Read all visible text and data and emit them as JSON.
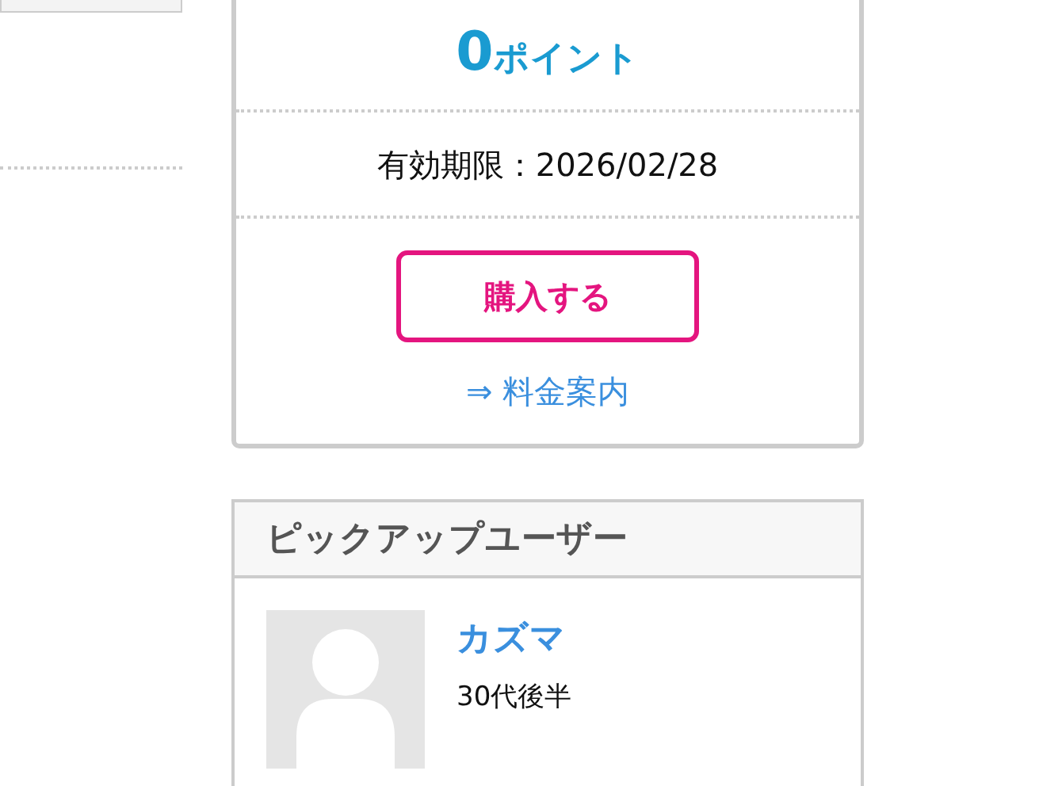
{
  "points": {
    "value": "0",
    "unit": "ポイント"
  },
  "expiry": "有効期限：2026/02/28",
  "buy_button": "購入する",
  "pricing_link": {
    "arrow": "⇒",
    "label": "料金案内"
  },
  "pickup": {
    "title": "ピックアップユーザー",
    "users": [
      {
        "name": "カズマ",
        "age": "30代後半"
      }
    ]
  }
}
